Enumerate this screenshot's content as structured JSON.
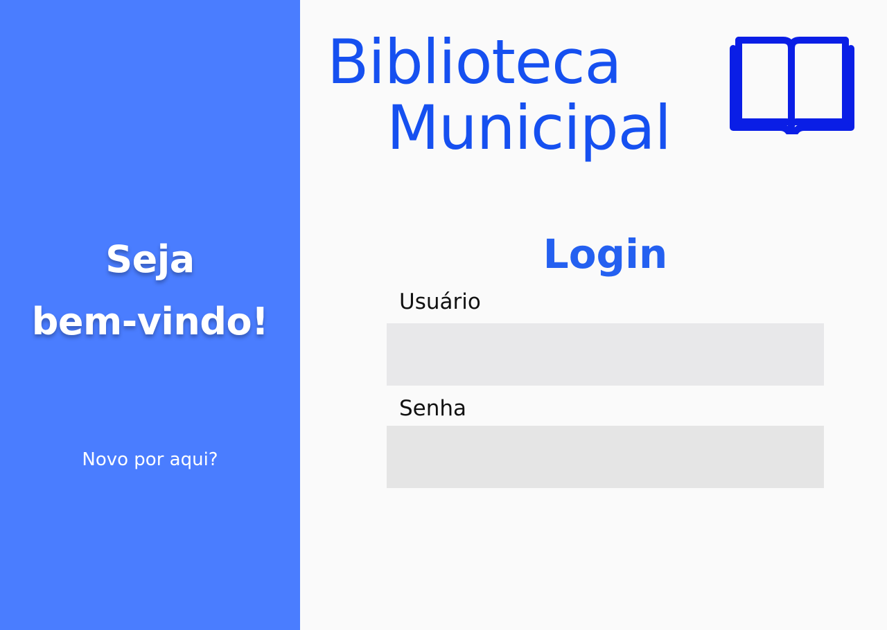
{
  "welcome": {
    "line1": "Seja",
    "line2": "bem-vindo!",
    "signup_link": "Novo por aqui?"
  },
  "header": {
    "title_line1": "Biblioteca",
    "title_line2": "Municipal",
    "icon": "open-book-icon"
  },
  "login": {
    "title": "Login",
    "username_label": "Usuário",
    "username_value": "",
    "password_label": "Senha",
    "password_value": ""
  },
  "colors": {
    "left_panel": "#4a7dff",
    "title": "#1650f0",
    "icon": "#0a1ee6",
    "login_title": "#2460f0",
    "input_bg": "#e8e8ea"
  }
}
